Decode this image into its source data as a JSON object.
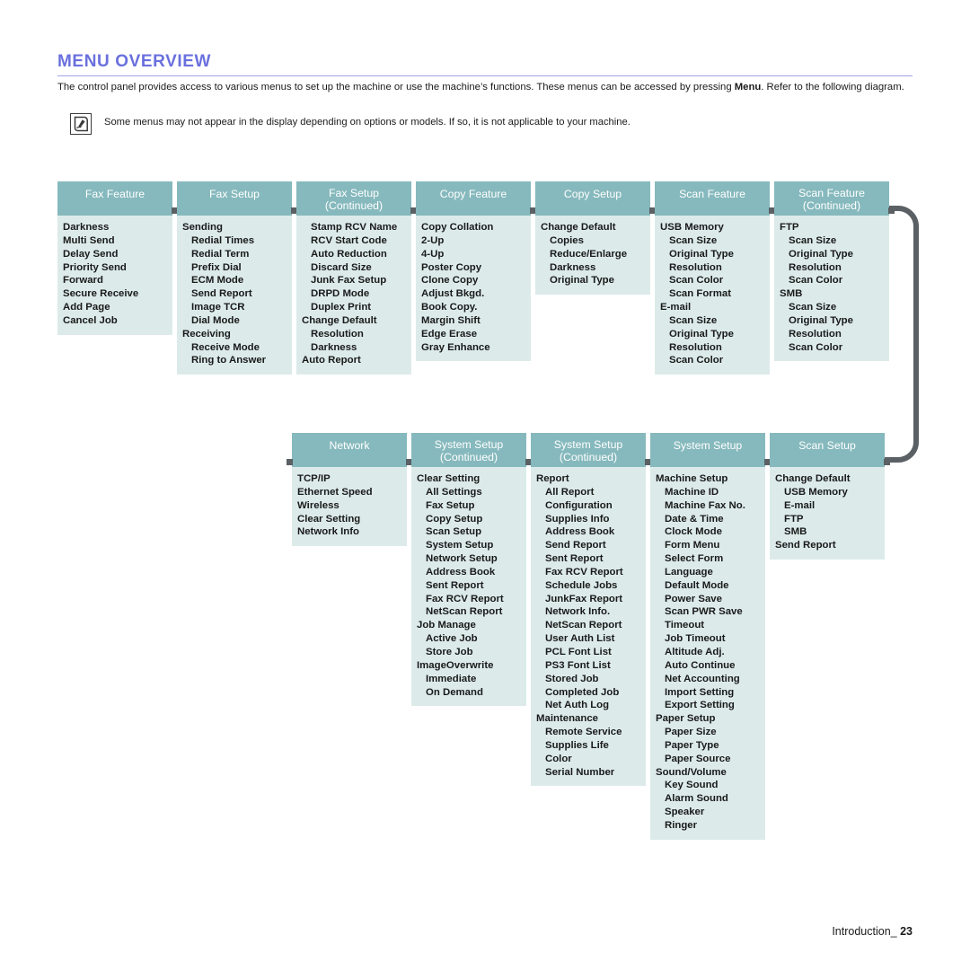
{
  "header": {
    "section_title": "MENU OVERVIEW",
    "intro_part1": "The control panel provides access to various menus to set up the machine or use the machine’s functions. These menus can be accessed by pressing ",
    "intro_bold": "Menu",
    "intro_part2": ". Refer to the following diagram."
  },
  "note": {
    "icon": "note-pen-icon",
    "text": "Some menus may not appear in the display depending on options or models. If so, it is not applicable to your machine."
  },
  "colors": {
    "header_accent": "#6a70dd",
    "column_header_bg": "#86b9bd",
    "column_body_bg": "#dcebea",
    "connector": "#5a6063",
    "text": "#1a1a1a"
  },
  "diagram": {
    "row1": [
      {
        "title": "Fax Feature",
        "subtitle": "",
        "items": [
          {
            "label": "Darkness",
            "level": 0
          },
          {
            "label": "Multi Send",
            "level": 0
          },
          {
            "label": "Delay Send",
            "level": 0
          },
          {
            "label": "Priority Send",
            "level": 0
          },
          {
            "label": "Forward",
            "level": 0
          },
          {
            "label": "Secure Receive",
            "level": 0
          },
          {
            "label": "Add Page",
            "level": 0
          },
          {
            "label": "Cancel Job",
            "level": 0
          }
        ]
      },
      {
        "title": "Fax Setup",
        "subtitle": "",
        "items": [
          {
            "label": "Sending",
            "level": 0
          },
          {
            "label": "Redial Times",
            "level": 1
          },
          {
            "label": "Redial Term",
            "level": 1
          },
          {
            "label": "Prefix Dial",
            "level": 1
          },
          {
            "label": "ECM Mode",
            "level": 1
          },
          {
            "label": "Send Report",
            "level": 1
          },
          {
            "label": "Image TCR",
            "level": 1
          },
          {
            "label": "Dial Mode",
            "level": 1
          },
          {
            "label": "Receiving",
            "level": 0
          },
          {
            "label": "Receive Mode",
            "level": 1
          },
          {
            "label": "Ring to Answer",
            "level": 1
          }
        ]
      },
      {
        "title": "Fax Setup",
        "subtitle": "(Continued)",
        "items": [
          {
            "label": "Stamp RCV Name",
            "level": 1
          },
          {
            "label": "RCV Start Code",
            "level": 1
          },
          {
            "label": "Auto Reduction",
            "level": 1
          },
          {
            "label": "Discard Size",
            "level": 1
          },
          {
            "label": "Junk Fax Setup",
            "level": 1
          },
          {
            "label": "DRPD Mode",
            "level": 1
          },
          {
            "label": "Duplex Print",
            "level": 1
          },
          {
            "label": "Change Default",
            "level": 0
          },
          {
            "label": "Resolution",
            "level": 1
          },
          {
            "label": "Darkness",
            "level": 1
          },
          {
            "label": "Auto Report",
            "level": 0
          }
        ]
      },
      {
        "title": "Copy Feature",
        "subtitle": "",
        "items": [
          {
            "label": "Copy Collation",
            "level": 0
          },
          {
            "label": "2-Up",
            "level": 0
          },
          {
            "label": "4-Up",
            "level": 0
          },
          {
            "label": "Poster Copy",
            "level": 0
          },
          {
            "label": "Clone Copy",
            "level": 0
          },
          {
            "label": "Adjust Bkgd.",
            "level": 0
          },
          {
            "label": "Book Copy.",
            "level": 0
          },
          {
            "label": "Margin Shift",
            "level": 0
          },
          {
            "label": "Edge Erase",
            "level": 0
          },
          {
            "label": "Gray Enhance",
            "level": 0
          }
        ]
      },
      {
        "title": "Copy Setup",
        "subtitle": "",
        "items": [
          {
            "label": "Change Default",
            "level": 0
          },
          {
            "label": "Copies",
            "level": 1
          },
          {
            "label": "Reduce/Enlarge",
            "level": 1
          },
          {
            "label": "Darkness",
            "level": 1
          },
          {
            "label": "Original Type",
            "level": 1
          }
        ]
      },
      {
        "title": "Scan Feature",
        "subtitle": "",
        "items": [
          {
            "label": "USB Memory",
            "level": 0
          },
          {
            "label": "Scan Size",
            "level": 1
          },
          {
            "label": "Original Type",
            "level": 1
          },
          {
            "label": "Resolution",
            "level": 1
          },
          {
            "label": "Scan Color",
            "level": 1
          },
          {
            "label": "Scan Format",
            "level": 1
          },
          {
            "label": "E-mail",
            "level": 0
          },
          {
            "label": "Scan Size",
            "level": 1
          },
          {
            "label": "Original Type",
            "level": 1
          },
          {
            "label": "Resolution",
            "level": 1
          },
          {
            "label": "Scan Color",
            "level": 1
          }
        ]
      },
      {
        "title": "Scan Feature",
        "subtitle": "(Continued)",
        "items": [
          {
            "label": "FTP",
            "level": 0
          },
          {
            "label": "Scan Size",
            "level": 1
          },
          {
            "label": "Original Type",
            "level": 1
          },
          {
            "label": "Resolution",
            "level": 1
          },
          {
            "label": "Scan Color",
            "level": 1
          },
          {
            "label": "SMB",
            "level": 0
          },
          {
            "label": "Scan Size",
            "level": 1
          },
          {
            "label": "Original Type",
            "level": 1
          },
          {
            "label": "Resolution",
            "level": 1
          },
          {
            "label": "Scan Color",
            "level": 1
          }
        ]
      }
    ],
    "row2": [
      {
        "title": "Network",
        "subtitle": "",
        "items": [
          {
            "label": "TCP/IP",
            "level": 0
          },
          {
            "label": "Ethernet Speed",
            "level": 0
          },
          {
            "label": "Wireless",
            "level": 0
          },
          {
            "label": "Clear Setting",
            "level": 0
          },
          {
            "label": "Network Info",
            "level": 0
          }
        ]
      },
      {
        "title": "System Setup",
        "subtitle": "(Continued)",
        "items": [
          {
            "label": "Clear Setting",
            "level": 0
          },
          {
            "label": "All Settings",
            "level": 1
          },
          {
            "label": "Fax Setup",
            "level": 1
          },
          {
            "label": "Copy Setup",
            "level": 1
          },
          {
            "label": "Scan Setup",
            "level": 1
          },
          {
            "label": "System Setup",
            "level": 1
          },
          {
            "label": "Network Setup",
            "level": 1
          },
          {
            "label": "Address Book",
            "level": 1
          },
          {
            "label": "Sent Report",
            "level": 1
          },
          {
            "label": "Fax RCV Report",
            "level": 1
          },
          {
            "label": "NetScan Report",
            "level": 1
          },
          {
            "label": "Job Manage",
            "level": 0
          },
          {
            "label": "Active Job",
            "level": 1
          },
          {
            "label": "Store Job",
            "level": 1
          },
          {
            "label": "ImageOverwrite",
            "level": 0
          },
          {
            "label": "Immediate",
            "level": 1
          },
          {
            "label": "On Demand",
            "level": 1
          }
        ]
      },
      {
        "title": "System Setup",
        "subtitle": "(Continued)",
        "items": [
          {
            "label": "Report",
            "level": 0
          },
          {
            "label": "All Report",
            "level": 1
          },
          {
            "label": "Configuration",
            "level": 1
          },
          {
            "label": "Supplies Info",
            "level": 1
          },
          {
            "label": "Address Book",
            "level": 1
          },
          {
            "label": "Send Report",
            "level": 1
          },
          {
            "label": "Sent Report",
            "level": 1
          },
          {
            "label": "Fax RCV Report",
            "level": 1
          },
          {
            "label": "Schedule Jobs",
            "level": 1
          },
          {
            "label": "JunkFax Report",
            "level": 1
          },
          {
            "label": "Network Info.",
            "level": 1
          },
          {
            "label": "NetScan Report",
            "level": 1
          },
          {
            "label": "User Auth List",
            "level": 1
          },
          {
            "label": "PCL Font List",
            "level": 1
          },
          {
            "label": "PS3 Font List",
            "level": 1
          },
          {
            "label": "Stored Job",
            "level": 1
          },
          {
            "label": "Completed Job",
            "level": 1
          },
          {
            "label": "Net Auth Log",
            "level": 1
          },
          {
            "label": "Maintenance",
            "level": 0
          },
          {
            "label": "Remote Service",
            "level": 1
          },
          {
            "label": "Supplies Life",
            "level": 1
          },
          {
            "label": "Color",
            "level": 1
          },
          {
            "label": "Serial Number",
            "level": 1
          }
        ]
      },
      {
        "title": "System Setup",
        "subtitle": "",
        "items": [
          {
            "label": "Machine Setup",
            "level": 0
          },
          {
            "label": "Machine ID",
            "level": 1
          },
          {
            "label": "Machine Fax No.",
            "level": 1
          },
          {
            "label": "Date & Time",
            "level": 1
          },
          {
            "label": "Clock Mode",
            "level": 1
          },
          {
            "label": "Form Menu",
            "level": 1
          },
          {
            "label": "Select Form",
            "level": 1
          },
          {
            "label": "Language",
            "level": 1
          },
          {
            "label": "Default Mode",
            "level": 1
          },
          {
            "label": "Power Save",
            "level": 1
          },
          {
            "label": "Scan PWR Save",
            "level": 1
          },
          {
            "label": "Timeout",
            "level": 1
          },
          {
            "label": "Job Timeout",
            "level": 1
          },
          {
            "label": "Altitude Adj.",
            "level": 1
          },
          {
            "label": "Auto Continue",
            "level": 1
          },
          {
            "label": "Net Accounting",
            "level": 1
          },
          {
            "label": "Import Setting",
            "level": 1
          },
          {
            "label": "Export Setting",
            "level": 1
          },
          {
            "label": "Paper Setup",
            "level": 0
          },
          {
            "label": "Paper Size",
            "level": 1
          },
          {
            "label": "Paper Type",
            "level": 1
          },
          {
            "label": "Paper Source",
            "level": 1
          },
          {
            "label": "Sound/Volume",
            "level": 0
          },
          {
            "label": "Key Sound",
            "level": 1
          },
          {
            "label": "Alarm Sound",
            "level": 1
          },
          {
            "label": "Speaker",
            "level": 1
          },
          {
            "label": "Ringer",
            "level": 1
          }
        ]
      },
      {
        "title": "Scan Setup",
        "subtitle": "",
        "items": [
          {
            "label": "Change Default",
            "level": 0
          },
          {
            "label": "USB Memory",
            "level": 1
          },
          {
            "label": "E-mail",
            "level": 1
          },
          {
            "label": "FTP",
            "level": 1
          },
          {
            "label": "SMB",
            "level": 1
          },
          {
            "label": "Send Report",
            "level": 0
          }
        ]
      }
    ]
  },
  "footer": {
    "label": "Introduction_",
    "page_number": "23"
  }
}
